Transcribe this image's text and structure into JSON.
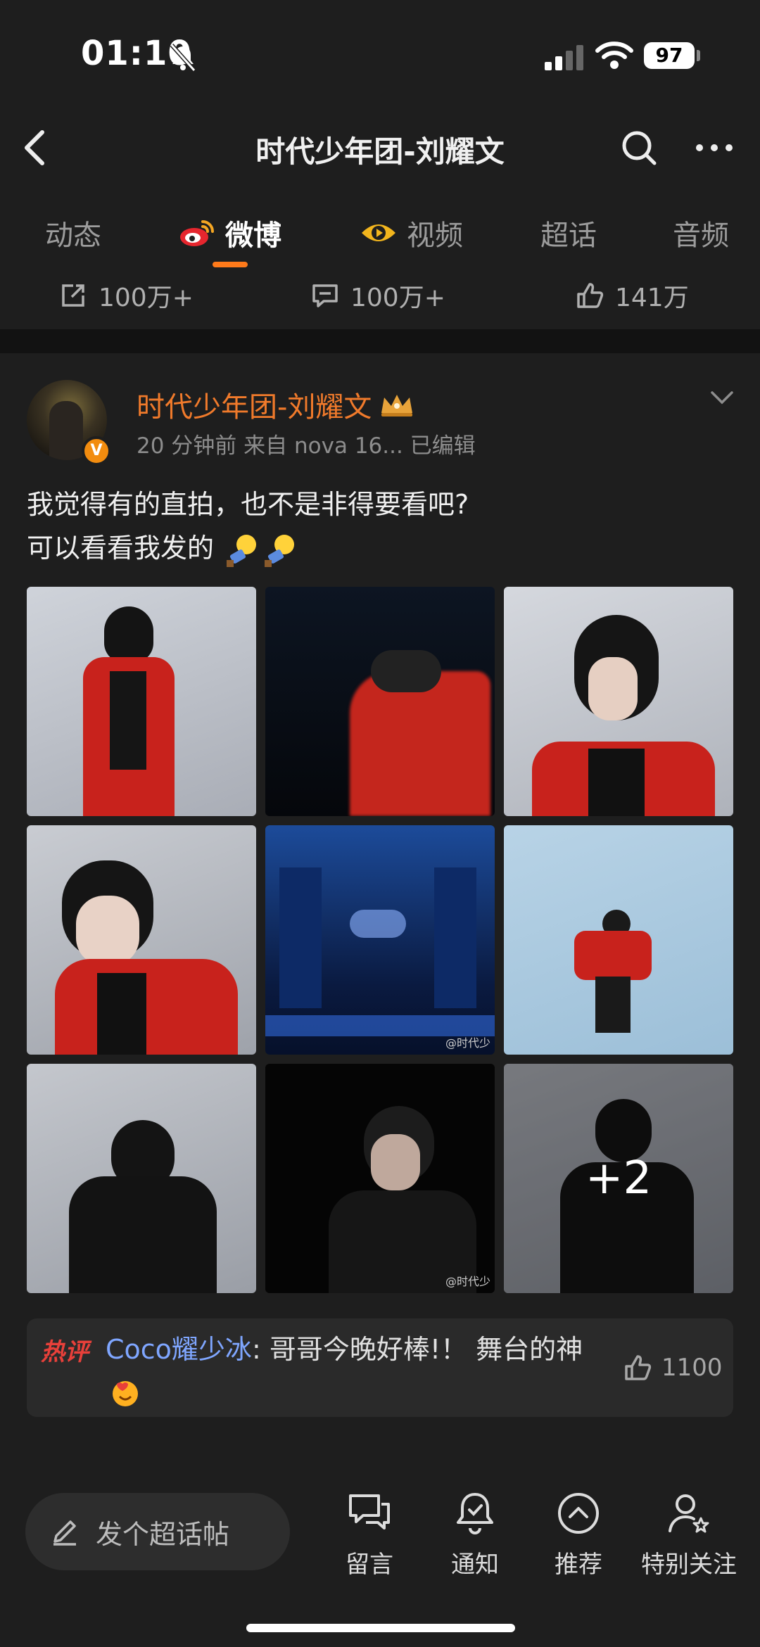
{
  "status_bar": {
    "time": "01:10",
    "battery": "97"
  },
  "header": {
    "title": "时代少年团-刘耀文"
  },
  "tabs": [
    {
      "label": "动态"
    },
    {
      "label": "微博"
    },
    {
      "label": "视频"
    },
    {
      "label": "超话"
    },
    {
      "label": "音频"
    }
  ],
  "top_stats": {
    "repost": "100万+",
    "comment": "100万+",
    "like": "141万"
  },
  "post": {
    "author": "时代少年团-刘耀文",
    "meta": "20 分钟前   来自 nova 16...   已编辑",
    "text_line1": "我觉得有的直拍，也不是非得要看吧?",
    "text_line2": "可以看看我发的",
    "more_count": "+2",
    "watermark": "@时代少"
  },
  "hot_comment": {
    "tag": "热评",
    "user": "Coco耀少冰",
    "text": ": 哥哥今晚好棒!！ 舞台的神",
    "likes": "1100"
  },
  "bottom_bar": {
    "compose_label": "发个超话帖",
    "items": [
      {
        "label": "留言"
      },
      {
        "label": "通知"
      },
      {
        "label": "推荐"
      },
      {
        "label": "特别关注"
      }
    ]
  },
  "colors": {
    "accent": "#ff7a1a",
    "author": "#f07a2b",
    "hot_tag": "#e8403a",
    "link": "#7fa6ff"
  }
}
